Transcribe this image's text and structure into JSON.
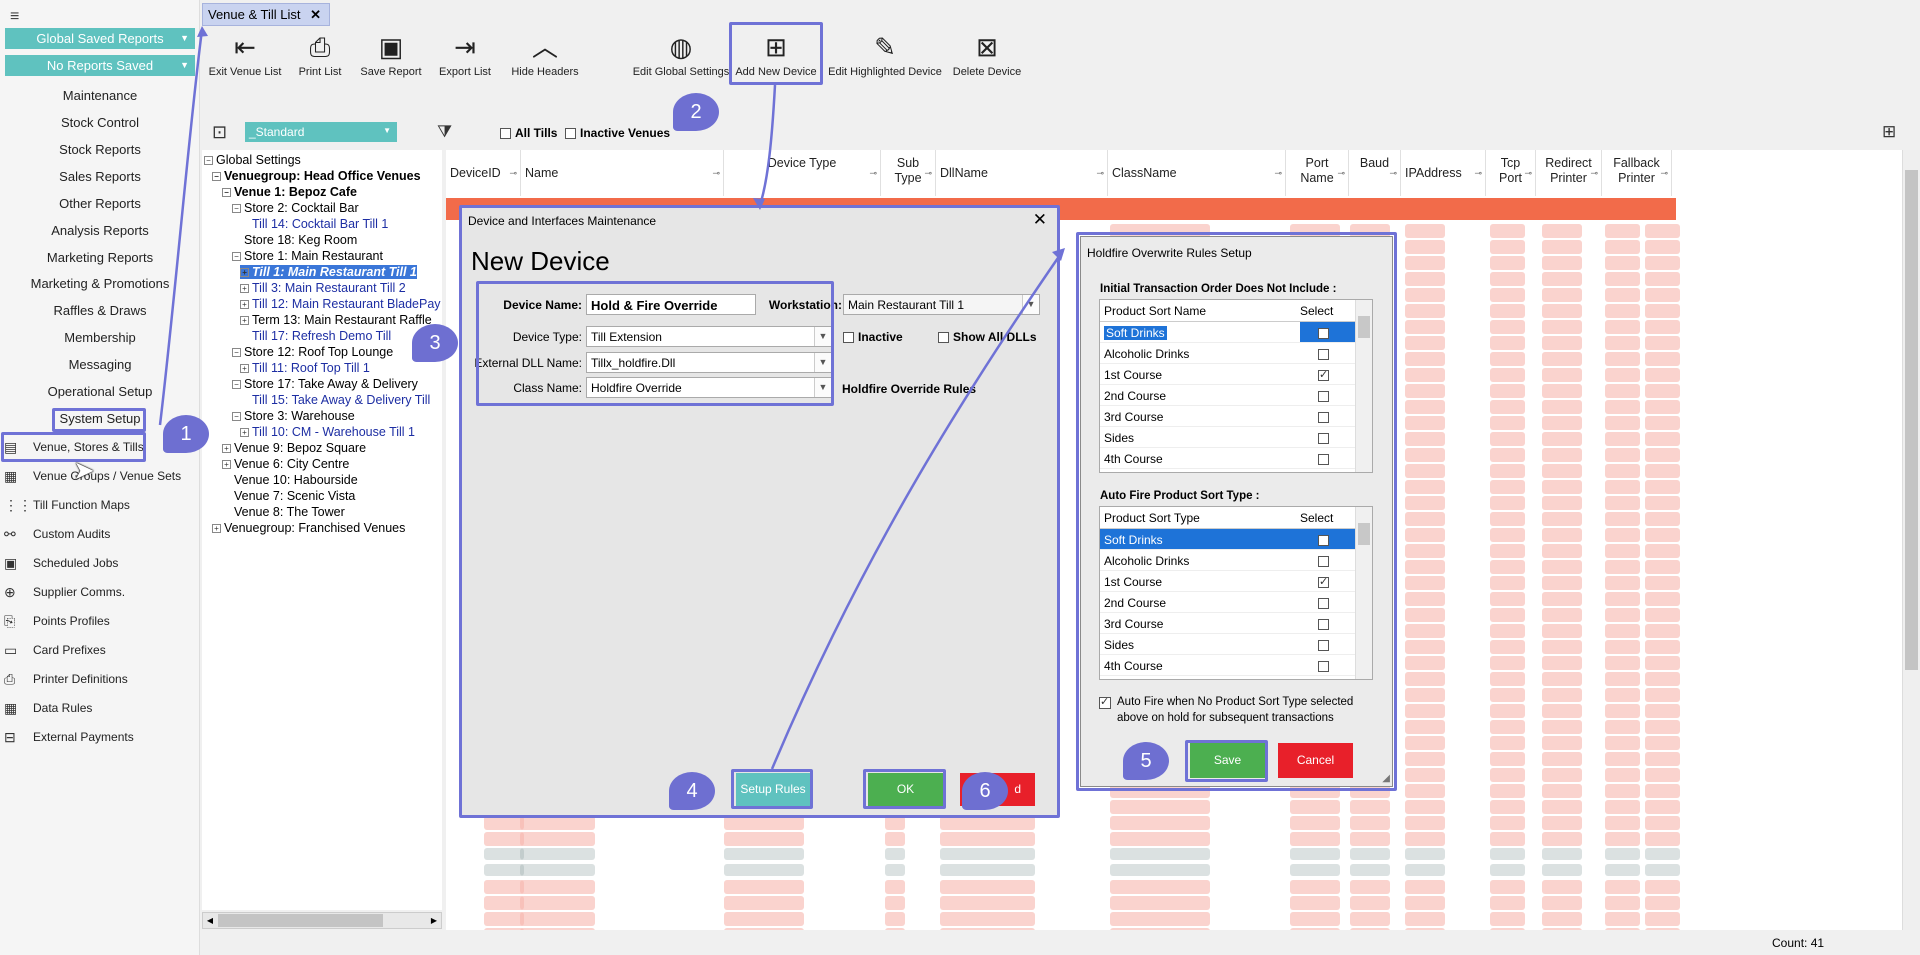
{
  "nav": {
    "global_saved_reports": "Global Saved Reports",
    "no_reports_saved": "No Reports Saved",
    "links": [
      "Maintenance",
      "Stock Control",
      "Stock Reports",
      "Sales Reports",
      "Other Reports",
      "Analysis Reports",
      "Marketing Reports",
      "Marketing & Promotions",
      "Raffles & Draws",
      "Membership",
      "Messaging",
      "Operational Setup",
      "System Setup"
    ],
    "items": [
      {
        "label": "Venue, Stores & Tills",
        "icon": "venue-icon"
      },
      {
        "label": "Venue Groups / Venue Sets",
        "icon": "venue-groups-icon"
      },
      {
        "label": "Till Function Maps",
        "icon": "grid-icon"
      },
      {
        "label": "Custom Audits",
        "icon": "audit-icon"
      },
      {
        "label": "Scheduled Jobs",
        "icon": "calendar-icon"
      },
      {
        "label": "Supplier Comms.",
        "icon": "upload-icon"
      },
      {
        "label": "Points Profiles",
        "icon": "document-icon"
      },
      {
        "label": "Card Prefixes",
        "icon": "card-icon"
      },
      {
        "label": "Printer Definitions",
        "icon": "printer-icon"
      },
      {
        "label": "Data Rules",
        "icon": "table-icon"
      },
      {
        "label": "External Payments",
        "icon": "payment-icon"
      }
    ]
  },
  "tab": {
    "label": "Venue & Till List"
  },
  "toolbar": [
    {
      "label": "Exit Venue List",
      "icon": "exit-icon"
    },
    {
      "label": "Print List",
      "icon": "printer-icon"
    },
    {
      "label": "Save Report",
      "icon": "save-icon"
    },
    {
      "label": "Export List",
      "icon": "export-icon"
    },
    {
      "label": "Hide Headers",
      "icon": "chevron-up-icon"
    },
    {
      "label": "Edit Global Settings",
      "icon": "globe-icon"
    },
    {
      "label": "Add New Device",
      "icon": "add-device-icon"
    },
    {
      "label": "Edit Highlighted Device",
      "icon": "edit-device-icon"
    },
    {
      "label": "Delete Device",
      "icon": "delete-device-icon"
    }
  ],
  "filters": {
    "layout": "_Standard",
    "all_tills": "All Tills",
    "inactive_venues": "Inactive Venues"
  },
  "tree": [
    {
      "label": "Global Settings",
      "lvl": 0,
      "pm": "-",
      "style": ""
    },
    {
      "label": "Venuegroup: Head Office Venues",
      "lvl": 1,
      "pm": "-",
      "style": "b"
    },
    {
      "label": "Venue 1: Bepoz Cafe",
      "lvl": 2,
      "pm": "-",
      "style": "b"
    },
    {
      "label": "Store 2: Cocktail Bar",
      "lvl": 3,
      "pm": "-",
      "style": ""
    },
    {
      "label": "Till 14: Cocktail Bar Till 1",
      "lvl": 4,
      "pm": "",
      "style": "blue"
    },
    {
      "label": "Store 18: Keg Room",
      "lvl": 3,
      "pm": "",
      "style": ""
    },
    {
      "label": "Store 1: Main Restaurant",
      "lvl": 3,
      "pm": "-",
      "style": ""
    },
    {
      "label": "Till 1: Main Restaurant Till 1",
      "lvl": 4,
      "pm": "+",
      "style": "sel"
    },
    {
      "label": "Till 3: Main Restaurant Till 2",
      "lvl": 4,
      "pm": "+",
      "style": "blue"
    },
    {
      "label": "Till 12: Main Restaurant BladePay",
      "lvl": 4,
      "pm": "+",
      "style": "blue"
    },
    {
      "label": "Term 13: Main Restaurant Raffle",
      "lvl": 4,
      "pm": "+",
      "style": ""
    },
    {
      "label": "Till 17: Refresh Demo Till",
      "lvl": 4,
      "pm": "",
      "style": "blue"
    },
    {
      "label": "Store 12: Roof Top Lounge",
      "lvl": 3,
      "pm": "-",
      "style": ""
    },
    {
      "label": "Till 11: Roof Top Till 1",
      "lvl": 4,
      "pm": "+",
      "style": "blue"
    },
    {
      "label": "Store 17: Take Away & Delivery",
      "lvl": 3,
      "pm": "-",
      "style": ""
    },
    {
      "label": "Till 15: Take Away & Delivery Till",
      "lvl": 4,
      "pm": "",
      "style": "blue"
    },
    {
      "label": "Store 3: Warehouse",
      "lvl": 3,
      "pm": "-",
      "style": ""
    },
    {
      "label": "Till 10: CM - Warehouse Till 1",
      "lvl": 4,
      "pm": "+",
      "style": "blue"
    },
    {
      "label": "Venue 9: Bepoz Square",
      "lvl": 2,
      "pm": "+",
      "style": ""
    },
    {
      "label": "Venue 6: City Centre",
      "lvl": 2,
      "pm": "+",
      "style": ""
    },
    {
      "label": "Venue 10: Habourside",
      "lvl": 2,
      "pm": "",
      "style": ""
    },
    {
      "label": "Venue 7: Scenic Vista",
      "lvl": 2,
      "pm": "",
      "style": ""
    },
    {
      "label": "Venue 8: The Tower",
      "lvl": 2,
      "pm": "",
      "style": ""
    },
    {
      "label": "Venuegroup: Franchised Venues",
      "lvl": 1,
      "pm": "+",
      "style": ""
    }
  ],
  "columns": [
    "DeviceID",
    "Name",
    "Device Type",
    "Sub Type",
    "DllName",
    "ClassName",
    "Port Name",
    "Baud",
    "IPAddress",
    "Tcp Port",
    "Redirect Printer",
    "Fallback Printer"
  ],
  "status": {
    "count": "Count: 41"
  },
  "device_dialog": {
    "title": "Device and Interfaces Maintenance",
    "heading": "New Device",
    "device_name_label": "Device Name:",
    "device_name": "Hold & Fire Override",
    "workstation_label": "Workstation:",
    "workstation": "Main Restaurant Till 1",
    "device_type_label": "Device Type:",
    "device_type": "Till Extension",
    "inactive": "Inactive",
    "show_all_dlls": "Show All DLLs",
    "dll_label": "External DLL Name:",
    "dll": "Tillx_holdfire.Dll",
    "class_label": "Class Name:",
    "class_name": "Holdfire Override",
    "rules_label": "Holdfire Override Rules",
    "setup_rules": "Setup Rules",
    "ok": "OK",
    "cancel_partial": "d"
  },
  "rules_dialog": {
    "title": "Holdfire Overwrite Rules Setup",
    "section1": "Initial Transaction Order Does Not Include :",
    "col1_name": "Product Sort Name",
    "col_select": "Select",
    "section2": "Auto Fire Product Sort Type :",
    "col2_name": "Product Sort Type",
    "items": [
      {
        "name": "Soft Drinks",
        "checked": false
      },
      {
        "name": "Alcoholic Drinks",
        "checked": false
      },
      {
        "name": "1st Course",
        "checked": true
      },
      {
        "name": "2nd Course",
        "checked": false
      },
      {
        "name": "3rd Course",
        "checked": false
      },
      {
        "name": "Sides",
        "checked": false
      },
      {
        "name": "4th Course",
        "checked": false
      }
    ],
    "auto_fire_text": "Auto Fire when No Product Sort Type selected above on hold for subsequent transactions",
    "save": "Save",
    "cancel": "Cancel"
  },
  "steps": [
    "1",
    "2",
    "3",
    "4",
    "5",
    "6"
  ],
  "colors": {
    "teal": "#5fc2bf",
    "highlight": "#6f72d6",
    "green": "#4caf50",
    "red": "#e8202a",
    "selection": "#1e73d8"
  }
}
